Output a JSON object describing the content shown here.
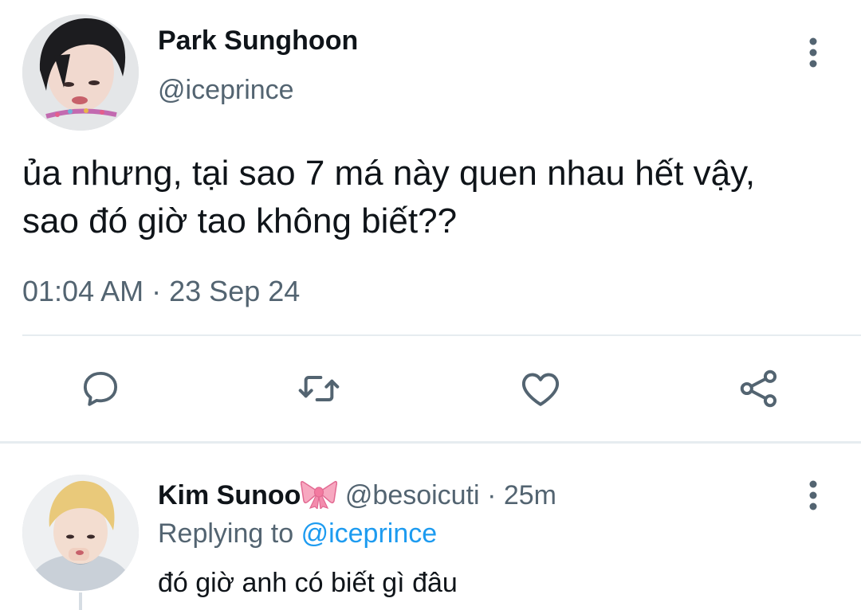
{
  "tweet": {
    "author_name": "Park Sunghoon",
    "author_handle": "@iceprince",
    "text_line1": "ủa nhưng, tại sao 7 má này quen nhau hết vậy,",
    "text_line2": "sao đó giờ tao không biết??",
    "time": "01:04 AM",
    "separator": "·",
    "date": "23 Sep 24",
    "avatar_icon": "profile-photo",
    "more_icon": "more-vertical-icon"
  },
  "actions": {
    "reply_icon": "reply-bubble-icon",
    "retweet_icon": "retweet-icon",
    "like_icon": "heart-icon",
    "share_icon": "share-icon"
  },
  "reply": {
    "author_name": "Kim Sunoo",
    "emoji_icon": "ribbon-bow-emoji",
    "author_handle": "@besoicuti",
    "separator": "·",
    "time": "25m",
    "replying_prefix": "Replying to",
    "replying_handle": "@iceprince",
    "text": "đó giờ anh có biết gì đâu"
  },
  "colors": {
    "text_primary": "#0f1419",
    "text_secondary": "#536471",
    "link": "#1d9bf0",
    "divider": "#e6ecf0",
    "icon": "#536471"
  }
}
